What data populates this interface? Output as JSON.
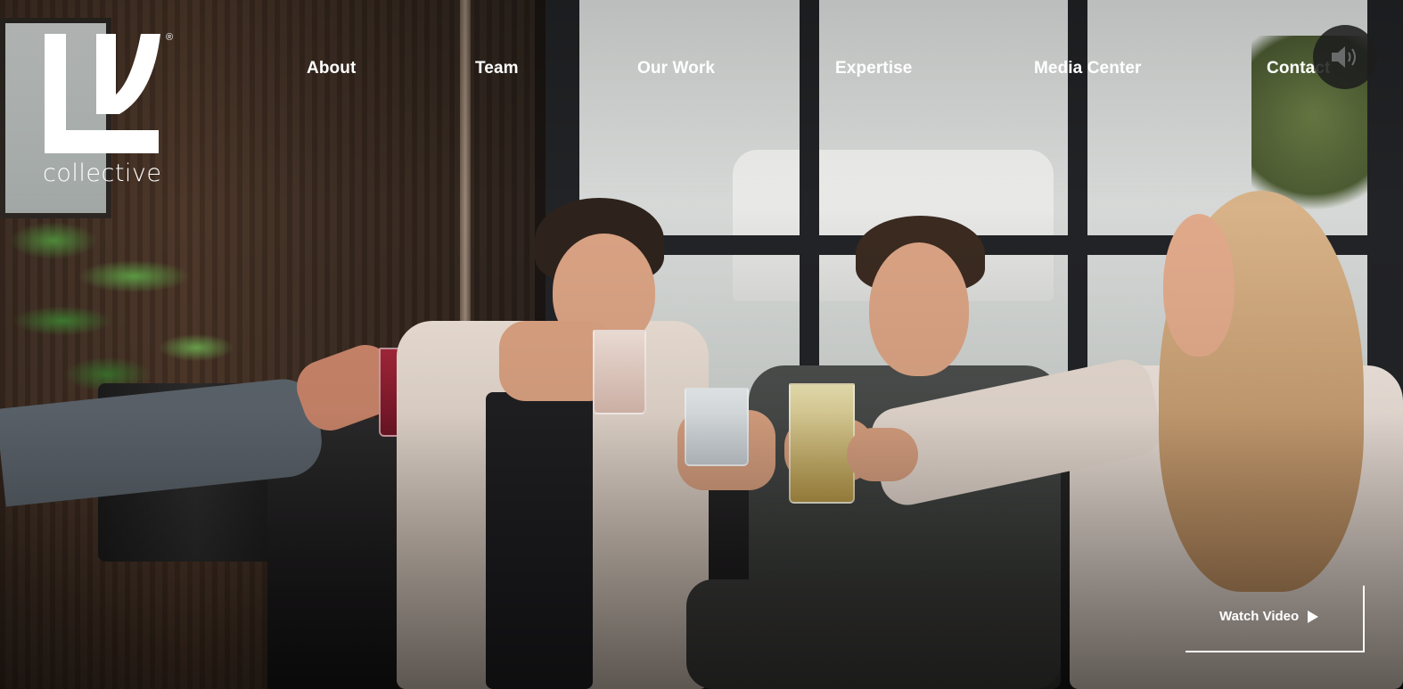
{
  "brand": {
    "logo_letters": "LV",
    "registered_mark": "®",
    "wordmark": "collective"
  },
  "nav": {
    "items": [
      {
        "label": "About"
      },
      {
        "label": "Team"
      },
      {
        "label": "Our Work"
      },
      {
        "label": "Expertise"
      },
      {
        "label": "Media Center"
      },
      {
        "label": "Contact"
      }
    ]
  },
  "controls": {
    "sound_icon": "speaker-icon",
    "watch_video_label": "Watch Video",
    "play_icon": "play-icon"
  },
  "colors": {
    "text": "#ffffff",
    "sound_button_bg": "#1e1e1e"
  }
}
